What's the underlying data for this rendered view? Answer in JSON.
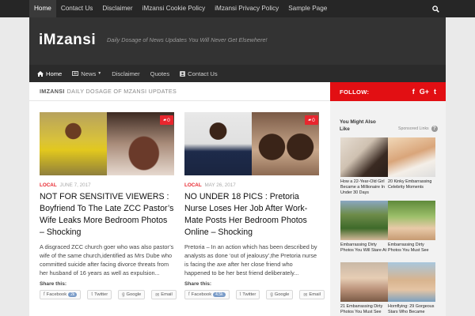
{
  "topnav": {
    "links": [
      "Home",
      "Contact Us",
      "Disclaimer",
      "iMzansi Cookie Policy",
      "iMzansi Privacy Policy",
      "Sample Page"
    ]
  },
  "header": {
    "title": "iMzansi",
    "tagline": "Daily Dosage of News Updates You Will Never Get Elsewhere!"
  },
  "mainnav": {
    "items": [
      {
        "label": "Home",
        "icon": "home-icon"
      },
      {
        "label": "News",
        "icon": "newspaper-icon"
      },
      {
        "label": "Disclaimer"
      },
      {
        "label": "Quotes"
      },
      {
        "label": "Contact Us",
        "icon": "contact-card-icon"
      }
    ]
  },
  "breadcrumb": {
    "site": "iMzansi",
    "subtitle": "Daily Dosage of Mzansi Updates"
  },
  "posts": [
    {
      "category": "LOCAL",
      "date": "JUNE 7, 2017",
      "comments": "0",
      "title": "NOT FOR SENSITIVE VIEWERS : Boyfriend To The Late ZCC Pastor’s Wife Leaks More Bedroom Photos – Shocking",
      "excerpt": "A disgraced ZCC church goer who was also pastor’s wife of the same church,identified as Mrs Dube who committed suicide after facing divorce threats from her husband of 16 years as well as expulsion...",
      "share_label": "Share this:",
      "share": {
        "facebook": "Facebook",
        "facebook_count": "2k",
        "twitter": "Twitter",
        "google": "Google",
        "email": "Email"
      }
    },
    {
      "category": "LOCAL",
      "date": "MAY 26, 2017",
      "comments": "0",
      "title": "NO UNDER 18 PICS : Pretoria Nurse Loses Her Job After Work-Mate Posts Her Bedroom Photos Online – Shocking",
      "excerpt": "Pretoria – In an action which has been described by analysts as done ‘out of jealousy’,the Pretoria nurse is facing the axe after her close friend who happened to be her best friend deliberately...",
      "share_label": "Share this:",
      "share": {
        "facebook": "Facebook",
        "facebook_count": "4.5k",
        "twitter": "Twitter",
        "google": "Google",
        "email": "Email"
      }
    }
  ],
  "sidebar": {
    "follow_label": "FOLLOW:",
    "socials": [
      "f",
      "G+",
      "t"
    ],
    "ymal": "You Might Also Like",
    "sponsored": "Sponsored Links",
    "ads": [
      "How a 22-Year-Old Girl Became a Millionaire In Under 30 Days",
      "20 Kinky Embarrassing Celebrity Moments",
      "Embarrassing Dirty Photos You Will Stare At",
      "Embarrassing Dirty Photos You Must See",
      "21 Embarrassing Dirty Photos You Must See",
      "Hornflying: 29 Gorgeous Stars Who Became"
    ]
  },
  "colors": {
    "accent_red": "#e20f13",
    "topbar_bg": "#262626",
    "header_bg": "#333333"
  }
}
